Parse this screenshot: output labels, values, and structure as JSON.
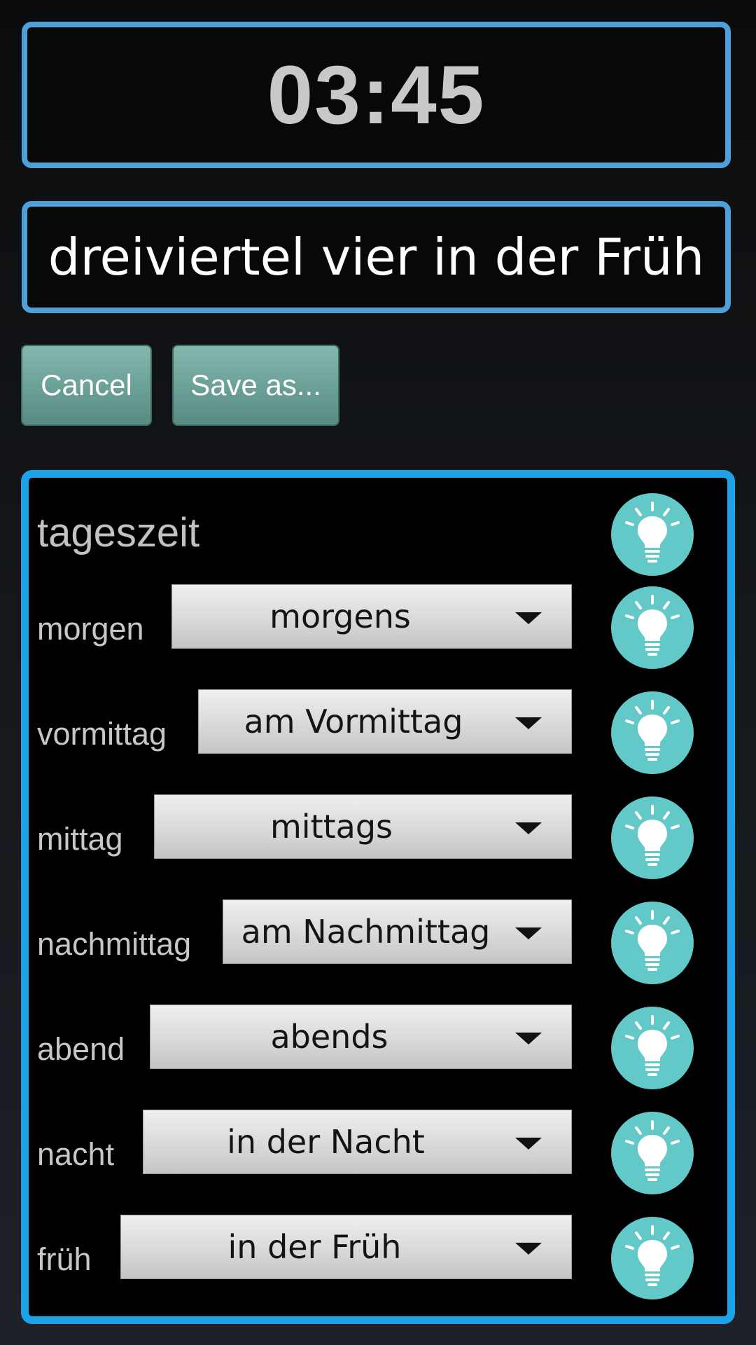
{
  "clock": {
    "time": "03:45"
  },
  "phrase": {
    "text": "dreiviertel vier in der Früh"
  },
  "buttons": {
    "cancel": "Cancel",
    "save_as": "Save as..."
  },
  "panel": {
    "title": "tageszeit",
    "rows": [
      {
        "label": "morgen",
        "value": "morgens"
      },
      {
        "label": "vormittag",
        "value": "am Vormittag"
      },
      {
        "label": "mittag",
        "value": "mittags"
      },
      {
        "label": "nachmittag",
        "value": "am Nachmittag"
      },
      {
        "label": "abend",
        "value": "abends"
      },
      {
        "label": "nacht",
        "value": "in der Nacht"
      },
      {
        "label": "früh",
        "value": "in der Früh"
      }
    ]
  },
  "icons": {
    "hint": "lightbulb-icon",
    "dropdown": "triangle-down-icon"
  },
  "colors": {
    "box_border": "#4f9fd8",
    "panel_border": "#1fa3e8",
    "button_fill": "#73a9a0",
    "bulb_fill": "#62c8c8"
  }
}
